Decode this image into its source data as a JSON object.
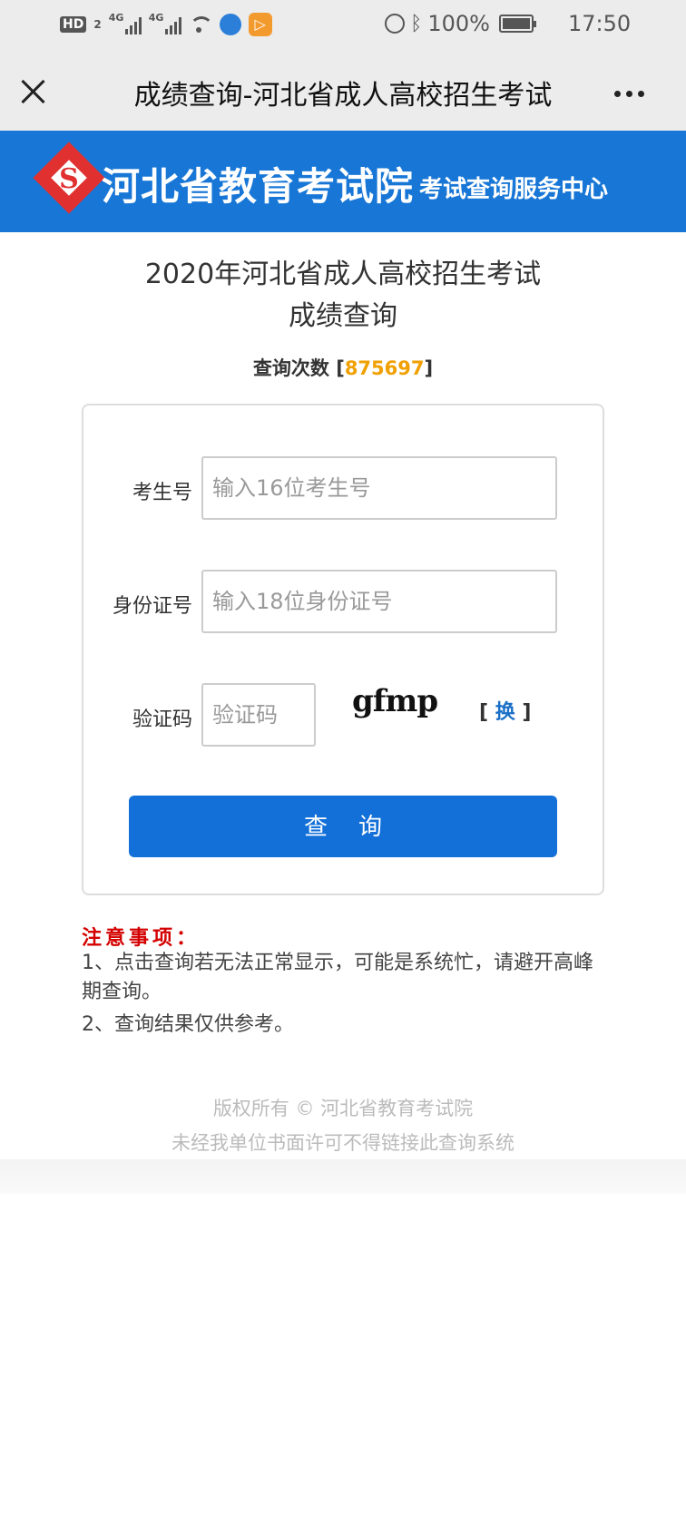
{
  "status_bar": {
    "hd": "HD",
    "hd_sub": "2",
    "sim1": "4G",
    "sim2": "4G",
    "battery_pct": "100%",
    "time": "17:50"
  },
  "nav": {
    "title": "成绩查询-河北省成人高校招生考试"
  },
  "banner": {
    "name": "河北省教育考试院",
    "subtitle": "考试查询服务中心"
  },
  "page": {
    "title_line1": "2020年河北省成人高校招生考试",
    "title_line2": "成绩查询",
    "counter_label": "查询次数 [",
    "counter_value": "875697",
    "counter_end": "]"
  },
  "form": {
    "exam_id_label": "考生号",
    "exam_id_placeholder": "输入16位考生号",
    "id_card_label": "身份证号",
    "id_card_placeholder": "输入18位身份证号",
    "captcha_label": "验证码",
    "captcha_placeholder": "验证码",
    "captcha_text": "gfmp",
    "refresh_open": "[ ",
    "refresh_label": "换",
    "refresh_close": " ]",
    "submit_label": "查询"
  },
  "notes": {
    "title": "注意事项：",
    "items": [
      "1、点击查询若无法正常显示，可能是系统忙，请避开高峰期查询。",
      "2、查询结果仅供参考。"
    ]
  },
  "footer": {
    "copyright": "版权所有 © 河北省教育考试院",
    "notice": "未经我单位书面许可不得链接此查询系统"
  }
}
